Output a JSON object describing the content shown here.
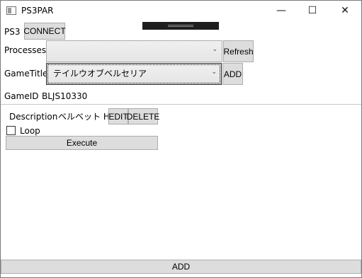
{
  "window": {
    "title": "PS3PAR",
    "minimize_glyph": "—",
    "maximize_glyph": "☐",
    "close_glyph": "✕",
    "icon": "app-window-icon"
  },
  "ps3": {
    "label": "PS3",
    "connect_label": "CONNECT"
  },
  "processes": {
    "label": "Processes",
    "selected": "",
    "refresh_label": "Refresh"
  },
  "game_title": {
    "label": "GameTitle",
    "selected": "テイルウオブベルセリア",
    "add_label": "ADD"
  },
  "game_id": {
    "label": "GameID",
    "value": "BLJS10330"
  },
  "code_entry": {
    "description_label": "Description",
    "description_value": "ベルベット HP",
    "edit_label": "EDIT",
    "delete_label": "DELETE",
    "loop_label": "Loop",
    "loop_checked": false,
    "execute_label": "Execute"
  },
  "footer": {
    "add_label": "ADD"
  },
  "icons": {
    "combo_arrow": "chevron-down-icon"
  }
}
